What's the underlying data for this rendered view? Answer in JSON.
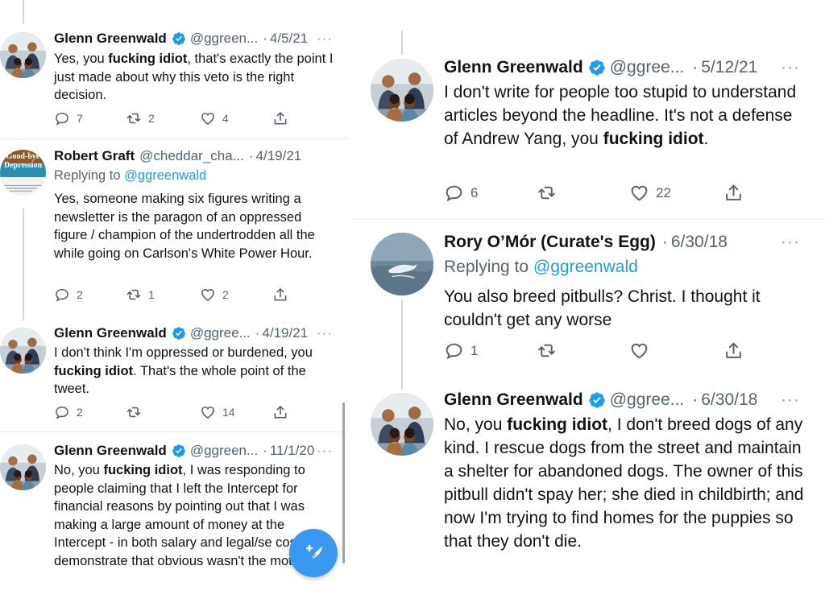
{
  "left": {
    "tweets": [
      {
        "name": "Glenn Greenwald",
        "handle": "@ggreen...",
        "dot": "·",
        "date": "4/5/21",
        "more": "···",
        "avatar_icon": "group-photo-avatar",
        "body_parts": [
          "Yes, you ",
          "fucking idiot",
          ", that's exactly the point I just made about why this veto is the right decision."
        ],
        "reply": "7",
        "retweet": "2",
        "like": "4"
      },
      {
        "name": "Robert Graft",
        "handle": "@cheddar_cha...",
        "dot": "·",
        "date": "4/19/21",
        "avatar_icon": "book-cover-avatar",
        "avatar_text": "Good-bye Depression",
        "replying_prefix": "Replying to",
        "replying_mention": "@ggreenwald",
        "body": "Yes, someone making six figures writing a newsletter is the paragon of an oppressed figure / champion of the undertrodden all the while going on Carlson's White Power Hour.",
        "reply": "2",
        "retweet": "1",
        "like": "2"
      },
      {
        "name": "Glenn Greenwald",
        "handle": "@ggree...",
        "dot": "·",
        "date": "4/19/21",
        "more": "···",
        "avatar_icon": "group-photo-avatar",
        "body_parts": [
          "I don't think I'm oppressed or burdened, you ",
          "fucking idiot",
          ". That's the whole point of the tweet."
        ],
        "reply": "2",
        "retweet": "",
        "like": "14"
      },
      {
        "name": "Glenn Greenwald",
        "handle": "@ggreen...",
        "dot": "·",
        "date": "11/1/20",
        "more": "···",
        "avatar_icon": "group-photo-avatar",
        "body_parts": [
          "No, you ",
          "fucking idiot",
          ", I was responding to people claiming that I left the Intercept for financial reasons by pointing out that I was making a large amount of money at the Intercept - in both salary and legal/se costs - to demonstrate that obvious wasn't the motive."
        ]
      }
    ]
  },
  "right": {
    "tweets": [
      {
        "name": "Glenn Greenwald",
        "handle": "@ggree...",
        "dot": "·",
        "date": "5/12/21",
        "more": "···",
        "avatar_icon": "group-photo-avatar",
        "body_parts": [
          "I don't write for people too stupid to understand articles beyond the headline. It's not a defense of Andrew Yang, you ",
          "fucking idiot",
          "."
        ],
        "reply": "6",
        "retweet": "",
        "like": "22"
      },
      {
        "name": "Rory O’Mór (Curate's Egg)",
        "handle": "",
        "dot": "·",
        "date": "6/30/18",
        "more": "···",
        "avatar_icon": "dolphin-photo-avatar",
        "replying_prefix": "Replying to",
        "replying_mention": "@ggreenwald",
        "body": "You also breed pitbulls? Christ. I thought it couldn't get any worse",
        "reply": "1",
        "retweet": "",
        "like": ""
      },
      {
        "name": "Glenn Greenwald",
        "handle": "@ggree...",
        "dot": "·",
        "date": "6/30/18",
        "more": "···",
        "avatar_icon": "group-photo-avatar",
        "body_parts": [
          "No, you ",
          "fucking idiot",
          ", I don't breed dogs of any kind. I rescue dogs from the street and maintain a shelter for abandoned dogs. The owner of this pitbull didn't spay her; she died in childbirth; and now I'm trying to find homes for the puppies so that they don't die."
        ]
      }
    ]
  },
  "icons": {
    "reply": "reply-icon",
    "retweet": "retweet-icon",
    "like": "heart-icon",
    "share": "share-icon",
    "verified": "verified-badge-icon",
    "compose": "compose-tweet-icon"
  },
  "colors": {
    "link": "#1d9bf0",
    "verified": "#1d9bf0",
    "fab": "#3a98f0",
    "muted": "#536471"
  }
}
